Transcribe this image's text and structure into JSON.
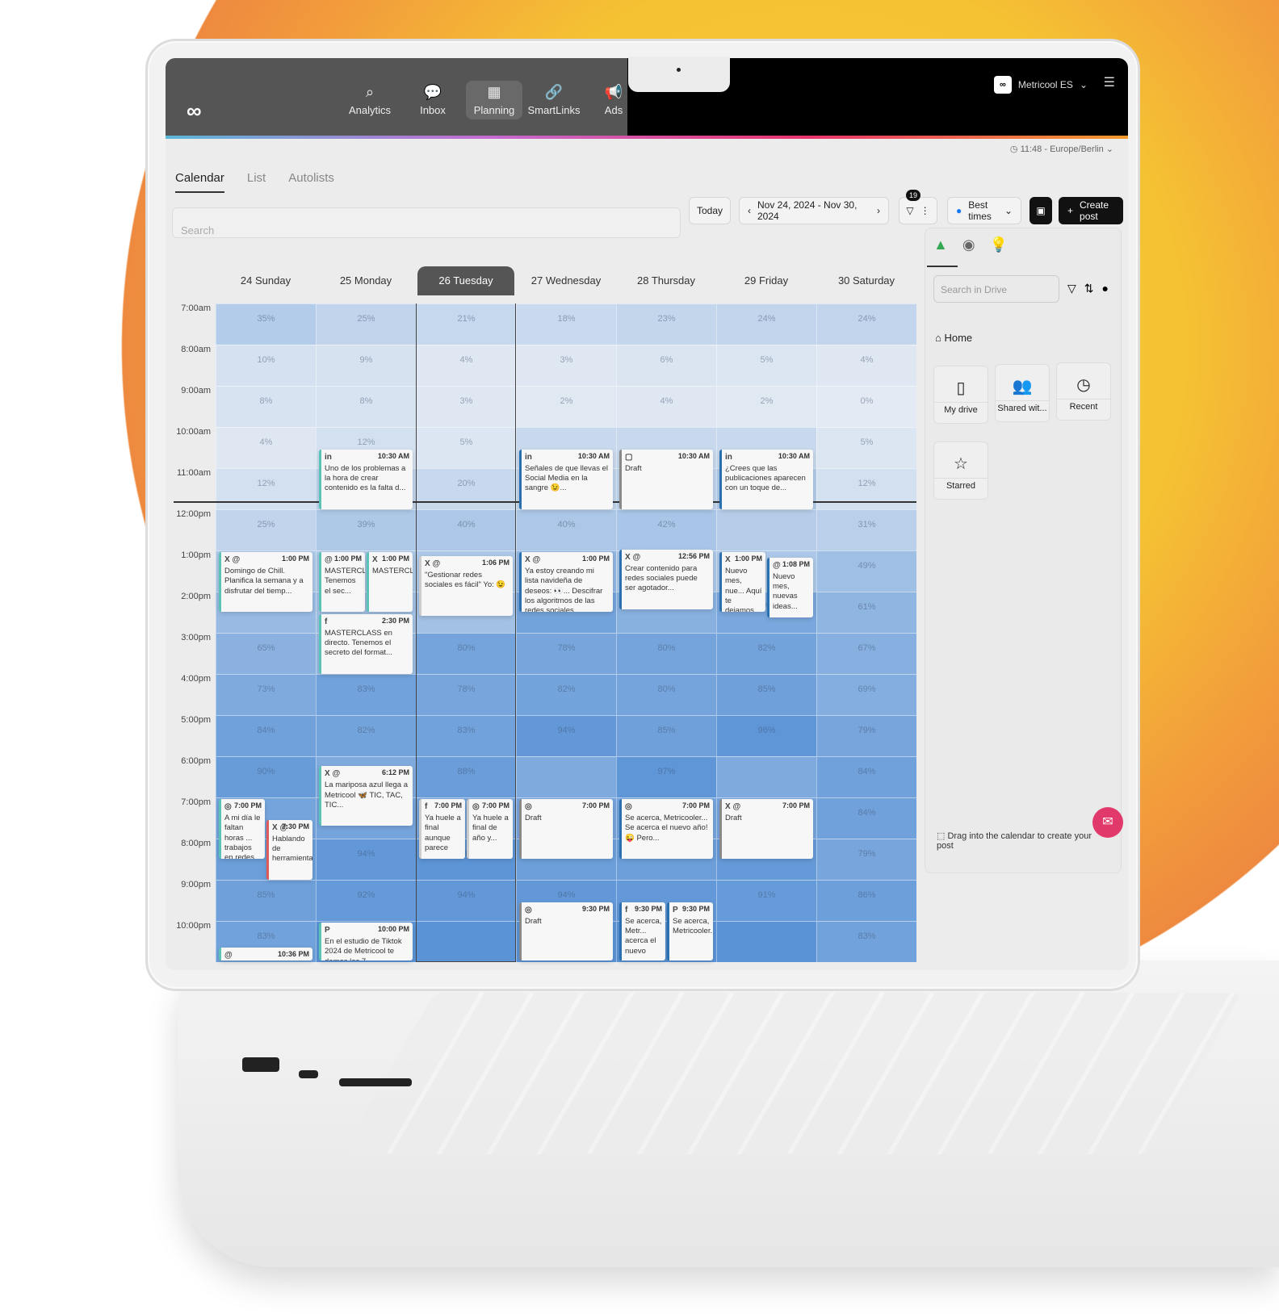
{
  "nav": {
    "items": [
      {
        "label": "Analytics",
        "icon": "analytics-icon"
      },
      {
        "label": "Inbox",
        "icon": "inbox-icon"
      },
      {
        "label": "Planning",
        "icon": "calendar-icon",
        "active": true
      },
      {
        "label": "SmartLinks",
        "icon": "link-icon"
      },
      {
        "label": "Ads",
        "icon": "megaphone-icon"
      }
    ],
    "account": "Metricool ES"
  },
  "timezone": "11:48 - Europe/Berlin",
  "tabs": [
    "Calendar",
    "List",
    "Autolists"
  ],
  "search_placeholder": "Search",
  "toolbar": {
    "today": "Today",
    "range": "Nov 24, 2024 - Nov 30, 2024",
    "filter_count": "19",
    "best_times": "Best times",
    "create": "Create post"
  },
  "days": [
    {
      "label": "24 Sunday"
    },
    {
      "label": "25 Monday"
    },
    {
      "label": "26 Tuesday",
      "today": true
    },
    {
      "label": "27 Wednesday"
    },
    {
      "label": "28 Thursday"
    },
    {
      "label": "29 Friday"
    },
    {
      "label": "30 Saturday"
    }
  ],
  "hours": [
    "7:00am",
    "8:00am",
    "9:00am",
    "10:00am",
    "11:00am",
    "12:00pm",
    "1:00pm",
    "2:00pm",
    "3:00pm",
    "4:00pm",
    "5:00pm",
    "6:00pm",
    "7:00pm",
    "8:00pm",
    "9:00pm",
    "10:00pm"
  ],
  "best_times_pct": [
    [
      35,
      10,
      8,
      4,
      12,
      25,
      null,
      54,
      65,
      73,
      84,
      90,
      null,
      null,
      85,
      83
    ],
    [
      25,
      9,
      8,
      12,
      null,
      39,
      null,
      null,
      null,
      83,
      82,
      null,
      null,
      94,
      92,
      null
    ],
    [
      21,
      4,
      3,
      5,
      20,
      40,
      null,
      null,
      80,
      78,
      83,
      88,
      null,
      98,
      94,
      null
    ],
    [
      18,
      3,
      2,
      null,
      null,
      40,
      60,
      82,
      78,
      82,
      94,
      null,
      null,
      null,
      94,
      null
    ],
    [
      23,
      6,
      4,
      null,
      null,
      42,
      null,
      66,
      80,
      80,
      85,
      97,
      null,
      null,
      null,
      null
    ],
    [
      24,
      5,
      2,
      null,
      36,
      null,
      null,
      77,
      82,
      85,
      96,
      null,
      null,
      92,
      91,
      null
    ],
    [
      24,
      4,
      0,
      5,
      12,
      31,
      49,
      61,
      67,
      69,
      79,
      84,
      84,
      79,
      86,
      83
    ]
  ],
  "heat_colors": {
    "low": "#e3eaf3",
    "high": "#5a93d6"
  },
  "events": [
    {
      "day": 1,
      "time": "10:30 AM",
      "net": "in",
      "text": "Uno de los problemas a la hora de crear contenido es la falta d...",
      "color": "#5bc3b5"
    },
    {
      "day": 3,
      "time": "10:30 AM",
      "net": "in",
      "text": "Señales de que llevas el Social Media en la sangre 😉...",
      "color": "#2a6fb0"
    },
    {
      "day": 4,
      "time": "10:30 AM",
      "net": "▢",
      "text": "Draft",
      "color": "#888"
    },
    {
      "day": 5,
      "time": "10:30 AM",
      "net": "in",
      "text": "¿Crees que las publicaciones aparecen con un toque de...",
      "color": "#2a6fb0"
    },
    {
      "day": 0,
      "time": "1:00 PM",
      "net": "X @",
      "text": "Domingo de Chill. Planifica la semana y a disfrutar del tiemp...",
      "color": "#5bc3b5"
    },
    {
      "day": 1,
      "time": "1:00 PM",
      "net": "@",
      "text": "MASTERCLASS Tenemos el sec...",
      "color": "#5bc3b5",
      "half": 0
    },
    {
      "day": 1,
      "time": "1:00 PM",
      "net": "X",
      "text": "MASTERCLA...",
      "color": "#5bc3b5",
      "half": 1
    },
    {
      "day": 2,
      "time": "1:06 PM",
      "net": "X @",
      "text": "\"Gestionar redes sociales es fácil\" Yo: 😉",
      "color": "#ccc"
    },
    {
      "day": 3,
      "time": "1:00 PM",
      "net": "X @",
      "text": "Ya estoy creando mi lista navideña de deseos: 👀... Descifrar los algoritmos de las redes sociales",
      "color": "#2a6fb0"
    },
    {
      "day": 4,
      "time": "12:56 PM",
      "net": "X @",
      "text": "Crear contenido para redes sociales puede ser agotador...",
      "color": "#2a6fb0"
    },
    {
      "day": 5,
      "time": "1:00 PM",
      "net": "X",
      "text": "Nuevo mes, nue... Aquí te dejamos",
      "color": "#2a6fb0",
      "half": 0
    },
    {
      "day": 5,
      "time": "1:08 PM",
      "net": "@",
      "text": "Nuevo mes, nuevas ideas...",
      "color": "#2a6fb0",
      "half": 1
    },
    {
      "day": 1,
      "time": "2:30 PM",
      "net": "f",
      "text": "MASTERCLASS en directo. Tenemos el secreto del format...",
      "color": "#5bc3b5"
    },
    {
      "day": 1,
      "time": "6:12 PM",
      "net": "X @",
      "text": "La mariposa azul llega a Metricool 🦋 TIC, TAC, TIC...",
      "color": "#5bc3b5"
    },
    {
      "day": 2,
      "time": "7:00 PM",
      "net": "f",
      "text": "Ya huele a final aunque parece",
      "color": "#ccc",
      "half": 0
    },
    {
      "day": 2,
      "time": "7:00 PM",
      "net": "◎",
      "text": "Ya huele a final de año y...",
      "color": "#ccc",
      "half": 1
    },
    {
      "day": 3,
      "time": "7:00 PM",
      "net": "◎",
      "text": "Draft",
      "color": "#888"
    },
    {
      "day": 4,
      "time": "7:00 PM",
      "net": "◎",
      "text": "Se acerca, Metricooler... Se acerca el nuevo año! 😜 Pero...",
      "color": "#2a6fb0"
    },
    {
      "day": 5,
      "time": "7:00 PM",
      "net": "X @",
      "text": "Draft",
      "color": "#888"
    },
    {
      "day": 0,
      "time": "7:00 PM",
      "net": "◎",
      "text": "A mi día le faltan horas ... trabajos en redes",
      "color": "#5bc3b5",
      "half": 0
    },
    {
      "day": 0,
      "time": "7:30 PM",
      "net": "X @",
      "text": "Hablando de herramientas...",
      "color": "#e05a5a",
      "half": 1
    },
    {
      "day": 3,
      "time": "9:30 PM",
      "net": "◎",
      "text": "Draft",
      "color": "#888"
    },
    {
      "day": 4,
      "time": "9:30 PM",
      "net": "f",
      "text": "Se acerca, Metr... acerca el nuevo",
      "color": "#2a6fb0",
      "half": 0
    },
    {
      "day": 4,
      "time": "9:30 PM",
      "net": "P",
      "text": "Se acerca, Metricooler....",
      "color": "#2a6fb0",
      "half": 1
    },
    {
      "day": 1,
      "time": "10:00 PM",
      "net": "P",
      "text": "En el estudio de Tiktok 2024 de Metricool te damos las 7...",
      "color": "#5bc3b5"
    },
    {
      "day": 0,
      "time": "10:36 PM",
      "net": "@",
      "text": "",
      "color": "#5bc3b5"
    }
  ],
  "panel": {
    "search_placeholder": "Search in Drive",
    "home": "Home",
    "tiles": [
      {
        "label": "My drive",
        "icon": "drive-file-icon"
      },
      {
        "label": "Shared wit...",
        "icon": "people-icon"
      },
      {
        "label": "Recent",
        "icon": "clock-icon"
      },
      {
        "label": "Starred",
        "icon": "star-icon"
      }
    ],
    "drag_hint": "Drag into the calendar to create your post"
  }
}
